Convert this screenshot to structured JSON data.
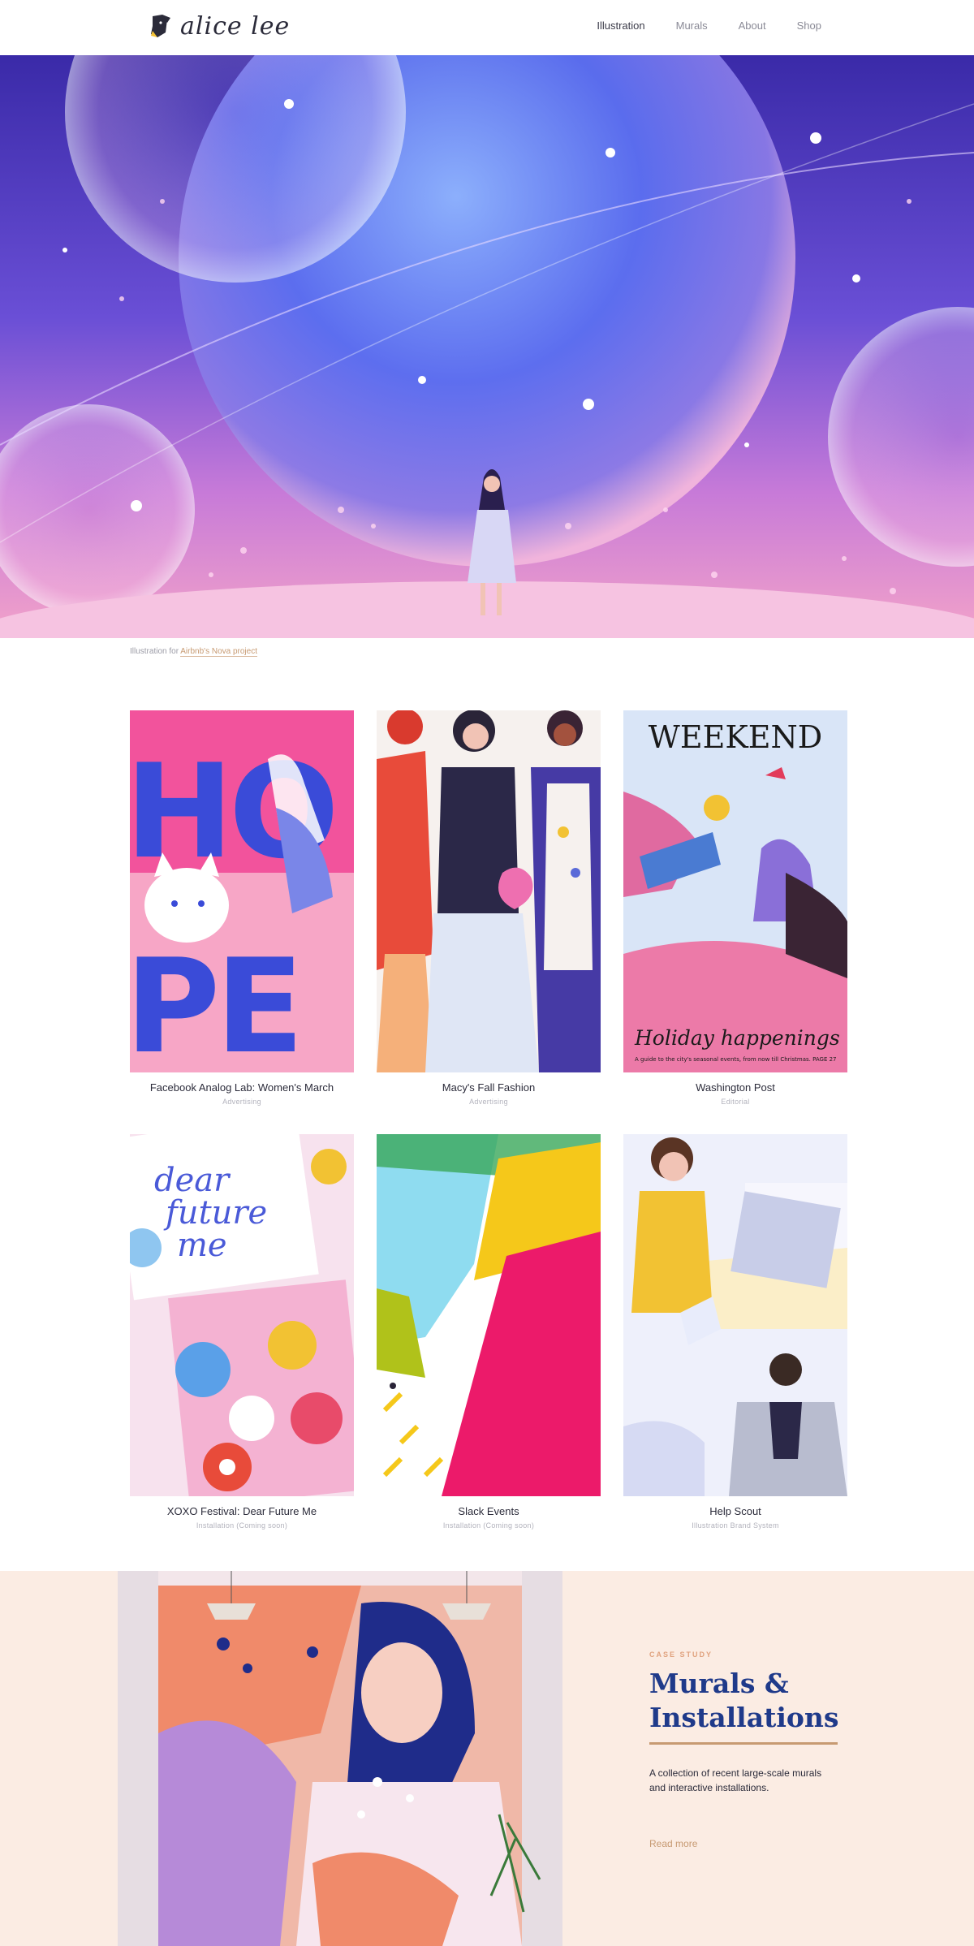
{
  "brand": {
    "name": "alice lee"
  },
  "nav": {
    "items": [
      {
        "label": "Illustration",
        "active": true
      },
      {
        "label": "Murals",
        "active": false
      },
      {
        "label": "About",
        "active": false
      },
      {
        "label": "Shop",
        "active": false
      }
    ]
  },
  "hero": {
    "caption_prefix": "Illustration for ",
    "caption_link": "Airbnb's Nova project"
  },
  "projects": [
    {
      "title": "Facebook Analog Lab: Women's March",
      "category": "Advertising",
      "art_text": "HOPE"
    },
    {
      "title": "Macy's Fall Fashion",
      "category": "Advertising"
    },
    {
      "title": "Washington Post",
      "category": "Editorial",
      "art_text": "WEEKEND",
      "art_text2": "Holiday happenings",
      "art_text3": "A guide to the city's seasonal events, from now till Christmas. PAGE 27"
    },
    {
      "title": "XOXO Festival: Dear Future Me",
      "category": "Installation (Coming soon)",
      "art_text": "dear future me"
    },
    {
      "title": "Slack Events",
      "category": "Installation (Coming soon)"
    },
    {
      "title": "Help Scout",
      "category": "Illustration Brand System"
    }
  ],
  "case_study": {
    "eyebrow": "CASE STUDY",
    "heading": "Murals & Installations",
    "description": "A collection of recent large-scale murals and interactive installations.",
    "link": "Read more"
  },
  "colors": {
    "accent": "#c79a72",
    "heading": "#1f3a8a",
    "case_bg": "#fbece3"
  }
}
